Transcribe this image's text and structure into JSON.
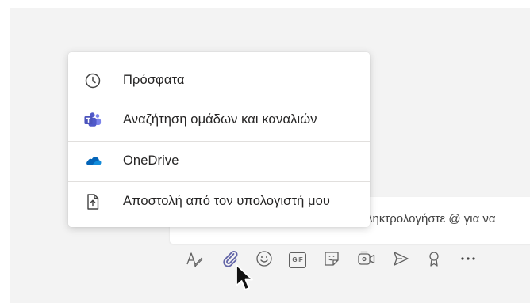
{
  "attach_menu": {
    "items": [
      {
        "id": "recent",
        "label": "Πρόσφατα",
        "icon": "clock-icon"
      },
      {
        "id": "browse-teams",
        "label": "Αναζήτηση ομάδων και καναλιών",
        "icon": "teams-icon"
      },
      {
        "id": "onedrive",
        "label": "OneDrive",
        "icon": "onedrive-cloud-icon"
      },
      {
        "id": "upload",
        "label": "Αποστολή από τον υπολογιστή μου",
        "icon": "upload-file-icon"
      }
    ]
  },
  "compose": {
    "placeholder_tail": "ληκτρολογήστε @ για να"
  },
  "toolbar": {
    "buttons": [
      {
        "id": "format",
        "icon": "format-icon"
      },
      {
        "id": "attach",
        "icon": "paperclip-icon",
        "active": true
      },
      {
        "id": "emoji",
        "icon": "emoji-icon"
      },
      {
        "id": "gif",
        "icon": "gif-icon",
        "label": "GIF"
      },
      {
        "id": "sticker",
        "icon": "sticker-icon"
      },
      {
        "id": "meet",
        "icon": "meet-now-icon"
      },
      {
        "id": "stream",
        "icon": "send-icon"
      },
      {
        "id": "praise",
        "icon": "praise-icon"
      },
      {
        "id": "more",
        "icon": "more-options-icon"
      }
    ]
  },
  "colors": {
    "accent": "#6264a7",
    "onedrive_blue": "#0364b8",
    "teams_purple": "#5b5fc7",
    "icon_gray": "#616161"
  }
}
